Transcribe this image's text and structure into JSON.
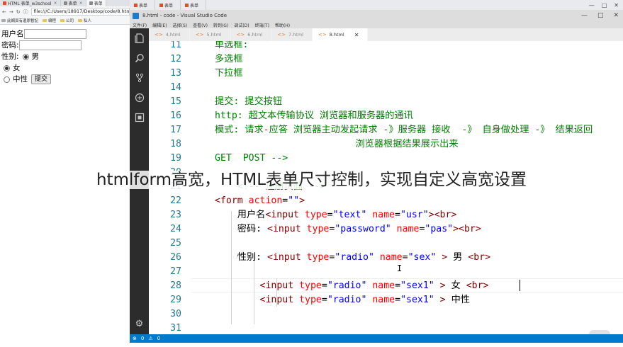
{
  "browser": {
    "tabs": [
      {
        "label": "HTML 表单_w3school",
        "active": false
      },
      {
        "label": "表单",
        "active": false
      },
      {
        "label": "表单",
        "active": true
      }
    ],
    "url": "file:///C:/Users/18917/Desktop/code/8.html",
    "bookmarks": [
      "此網頁有還原暫記",
      "编程",
      "公司",
      "私人"
    ],
    "form": {
      "username_label": "用户名",
      "password_label": "密码:",
      "gender_label": "性别:",
      "male_label": "男",
      "female_label": "女",
      "neutral_label": "中性",
      "submit_label": "提交"
    }
  },
  "vscode": {
    "window_title": "8.html - code - Visual Studio Code",
    "top_tabs": [
      "表单",
      "表单",
      "表单"
    ],
    "menu": [
      "文件(F)",
      "编辑(E)",
      "选择(S)",
      "查看(V)",
      "转到(G)",
      "调试(D)",
      "终端(T)",
      "帮助(H)"
    ],
    "editor_tabs": [
      {
        "label": "4.html",
        "active": false
      },
      {
        "label": "5.html",
        "active": false
      },
      {
        "label": "6.html",
        "active": false
      },
      {
        "label": "7.html",
        "active": false
      },
      {
        "label": "8.html",
        "active": true
      }
    ],
    "status": {
      "errors": "0",
      "warnings": "0"
    }
  },
  "code_lines": [
    {
      "n": "11",
      "parts": [
        [
          "kw",
          "单选框:"
        ]
      ]
    },
    {
      "n": "12",
      "parts": [
        [
          "kw",
          "多选框"
        ]
      ]
    },
    {
      "n": "13",
      "parts": [
        [
          "kw",
          "下拉框"
        ]
      ]
    },
    {
      "n": "14",
      "parts": []
    },
    {
      "n": "15",
      "parts": [
        [
          "kw",
          "提交: 提交按钮"
        ]
      ]
    },
    {
      "n": "16",
      "parts": [
        [
          "kw",
          "http: 超文本传输协议 浏览器和服务器的通讯"
        ]
      ]
    },
    {
      "n": "17",
      "parts": [
        [
          "kw",
          "模式: 请求-应答 浏览器主动发起请求 -》服务器 接收  -》 自身做处理 -》 结果返回"
        ]
      ]
    },
    {
      "n": "18",
      "parts": [
        [
          "kw",
          "                         浏览器根据结果展示出来"
        ]
      ]
    },
    {
      "n": "19",
      "parts": [
        [
          "kw",
          "GET  POST -->"
        ]
      ]
    },
    {
      "n": "20",
      "parts": []
    },
    {
      "n": "21",
      "parts": [
        [
          "kw",
          "    <!-- 注册页面 -->"
        ]
      ]
    },
    {
      "n": "22",
      "parts": [
        [
          "tag",
          "<form "
        ],
        [
          "attr",
          "action"
        ],
        [
          "plain",
          "="
        ],
        [
          "str",
          "\"\""
        ],
        [
          "tag",
          ">"
        ]
      ]
    },
    {
      "n": "23",
      "parts": [
        [
          "plain",
          "    用户名"
        ],
        [
          "tag",
          "<input "
        ],
        [
          "attr",
          "type"
        ],
        [
          "plain",
          "="
        ],
        [
          "str",
          "\"text\""
        ],
        [
          "plain",
          " "
        ],
        [
          "attr",
          "name"
        ],
        [
          "plain",
          "="
        ],
        [
          "str",
          "\"usr\""
        ],
        [
          "tag",
          "><br>"
        ]
      ]
    },
    {
      "n": "24",
      "parts": [
        [
          "plain",
          "    密码: "
        ],
        [
          "tag",
          "<input "
        ],
        [
          "attr",
          "type"
        ],
        [
          "plain",
          "="
        ],
        [
          "str",
          "\"password\""
        ],
        [
          "plain",
          " "
        ],
        [
          "attr",
          "name"
        ],
        [
          "plain",
          "="
        ],
        [
          "str",
          "\"pas\""
        ],
        [
          "tag",
          "><br>"
        ]
      ]
    },
    {
      "n": "25",
      "parts": []
    },
    {
      "n": "26",
      "parts": [
        [
          "plain",
          "    性别: "
        ],
        [
          "tag",
          "<input "
        ],
        [
          "attr",
          "type"
        ],
        [
          "plain",
          "="
        ],
        [
          "str",
          "\"radio\""
        ],
        [
          "plain",
          " "
        ],
        [
          "attr",
          "name"
        ],
        [
          "plain",
          "="
        ],
        [
          "str",
          "\"sex\""
        ],
        [
          "plain",
          " "
        ],
        [
          "tag",
          ">"
        ],
        [
          "plain",
          " 男 "
        ],
        [
          "tag",
          "<br>"
        ]
      ]
    },
    {
      "n": "27",
      "parts": []
    },
    {
      "n": "28",
      "parts": [
        [
          "plain",
          "        "
        ],
        [
          "tag",
          "<input "
        ],
        [
          "attr",
          "type"
        ],
        [
          "plain",
          "="
        ],
        [
          "str",
          "\"radio\""
        ],
        [
          "plain",
          " "
        ],
        [
          "attr",
          "name"
        ],
        [
          "plain",
          "="
        ],
        [
          "str",
          "\"sex1\""
        ],
        [
          "plain",
          " "
        ],
        [
          "tag",
          ">"
        ],
        [
          "plain",
          " 女 "
        ],
        [
          "tag",
          "<br>"
        ]
      ]
    },
    {
      "n": "29",
      "parts": [
        [
          "plain",
          "        "
        ],
        [
          "tag",
          "<input "
        ],
        [
          "attr",
          "type"
        ],
        [
          "plain",
          "="
        ],
        [
          "str",
          "\"radio\""
        ],
        [
          "plain",
          " "
        ],
        [
          "attr",
          "name"
        ],
        [
          "plain",
          "="
        ],
        [
          "str",
          "\"sex1\""
        ],
        [
          "plain",
          " "
        ],
        [
          "tag",
          ">"
        ],
        [
          "plain",
          " 中性"
        ]
      ]
    },
    {
      "n": "30",
      "parts": []
    },
    {
      "n": "31",
      "parts": []
    }
  ],
  "overlay": {
    "caption": "htmlform高宽，HTML表单尺寸控制，实现自定义高宽设置"
  },
  "colors": {
    "activity_bar": "#2c2c2c",
    "status_bar": "#007acc",
    "comment_green": "#008000",
    "tag_maroon": "#800000",
    "attr_red": "#ff0000",
    "string_blue": "#0000ff",
    "line_number": "#237893"
  },
  "icons": [
    "explorer-icon",
    "search-icon",
    "source-control-icon",
    "debug-icon",
    "extensions-icon",
    "settings-gear-icon",
    "play-icon"
  ]
}
